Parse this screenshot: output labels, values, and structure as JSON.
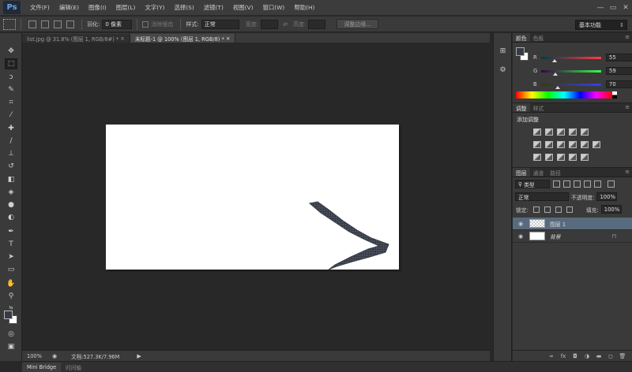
{
  "app": {
    "logo": "Ps"
  },
  "menu": [
    "文件(F)",
    "编辑(E)",
    "图像(I)",
    "图层(L)",
    "文字(Y)",
    "选择(S)",
    "滤镜(T)",
    "视图(V)",
    "窗口(W)",
    "帮助(H)"
  ],
  "window_controls": [
    "—",
    "▭",
    "✕"
  ],
  "options": {
    "feather_label": "羽化:",
    "feather_value": "0 像素",
    "antialias_label": "消除锯齿",
    "style_label": "样式:",
    "style_value": "正常",
    "width_label": "宽度:",
    "height_label": "高度:",
    "refine_button": "调整边缘...",
    "workspace": "基本功能"
  },
  "tabs": [
    {
      "label": "list.jpg @ 31.8% (图层 1, RGB/8#) *",
      "close": "×"
    },
    {
      "label": "未标题-1 @ 100% (图层 1, RGB/8) *",
      "close": "×"
    }
  ],
  "status": {
    "zoom": "100%",
    "doc_info": "文档:527.3K/7.96M"
  },
  "bottom_tabs": [
    "Mini Bridge",
    "时间轴"
  ],
  "color_panel": {
    "tabs": [
      "颜色",
      "色板"
    ],
    "channels": [
      {
        "letter": "R",
        "value": "55"
      },
      {
        "letter": "G",
        "value": "59"
      },
      {
        "letter": "B",
        "value": "70"
      }
    ],
    "foreground": "#373b46",
    "background": "#ffffff"
  },
  "adjust_panel": {
    "tabs": [
      "调整",
      "样式"
    ],
    "title": "添加调整"
  },
  "layers_panel": {
    "tabs": [
      "图层",
      "通道",
      "路径"
    ],
    "filter_kind": "类型",
    "blend_mode": "正常",
    "opacity_label": "不透明度:",
    "opacity_value": "100%",
    "lock_label": "锁定:",
    "fill_label": "填充:",
    "fill_value": "100%",
    "layers": [
      {
        "name": "图层 1",
        "selected": true
      },
      {
        "name": "背景",
        "selected": false
      }
    ]
  },
  "colors": {
    "canvas_bg": "#282828",
    "stroke": "#373b46"
  }
}
